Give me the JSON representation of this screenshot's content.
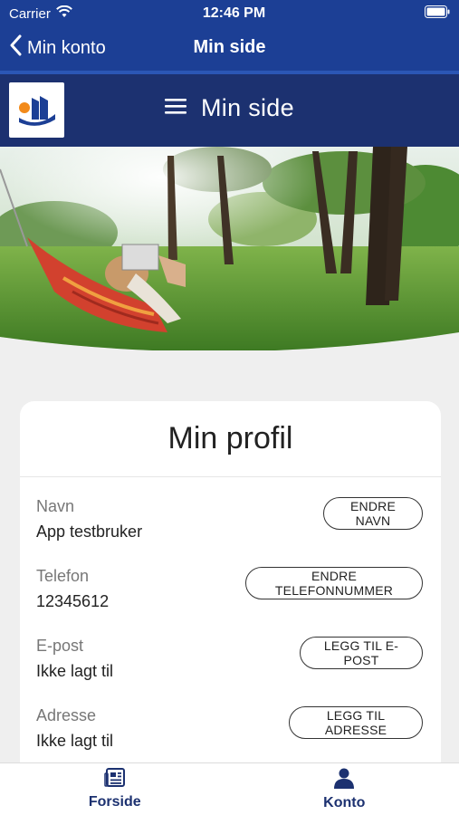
{
  "status_bar": {
    "carrier": "Carrier",
    "time": "12:46 PM"
  },
  "nav": {
    "back_label": "Min konto",
    "title": "Min side"
  },
  "header": {
    "title": "Min side"
  },
  "profile": {
    "title": "Min profil",
    "rows": [
      {
        "label": "Navn",
        "value": "App testbruker",
        "button": "ENDRE NAVN"
      },
      {
        "label": "Telefon",
        "value": "12345612",
        "button": "ENDRE TELEFONNUMMER"
      },
      {
        "label": "E-post",
        "value": "Ikke lagt til",
        "button": "LEGG TIL E-POST"
      },
      {
        "label": "Adresse",
        "value": "Ikke lagt til",
        "button": "LEGG TIL ADRESSE"
      }
    ]
  },
  "tabs": [
    {
      "label": "Forside",
      "icon": "newspaper-icon"
    },
    {
      "label": "Konto",
      "icon": "person-icon"
    }
  ],
  "colors": {
    "primary": "#1c3f95",
    "header_bg": "#1c3170",
    "accent_orange": "#f28a1a"
  }
}
